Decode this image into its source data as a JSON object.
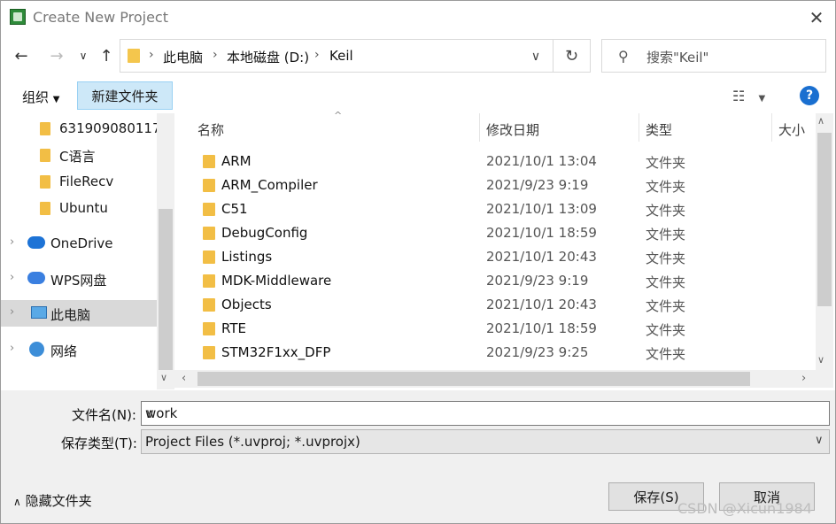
{
  "window": {
    "title": "Create New Project"
  },
  "nav": {
    "back_icon": "arrow-left-icon",
    "forward_icon": "arrow-right-icon",
    "recent_icon": "chevron-down-icon",
    "up_icon": "arrow-up-icon",
    "breadcrumb": [
      "此电脑",
      "本地磁盘 (D:)",
      "Keil"
    ],
    "search_placeholder": "搜索\"Keil\""
  },
  "toolbar": {
    "organize_label": "组织",
    "new_folder_label": "新建文件夹",
    "help_label": "?"
  },
  "sidebar": {
    "items": [
      {
        "label": "631909080117",
        "icon": "folder-icon"
      },
      {
        "label": "C语言",
        "icon": "folder-icon"
      },
      {
        "label": "FileRecv",
        "icon": "folder-icon"
      },
      {
        "label": "Ubuntu",
        "icon": "folder-icon"
      },
      {
        "label": "OneDrive",
        "icon": "onedrive-icon"
      },
      {
        "label": "WPS网盘",
        "icon": "wps-cloud-icon"
      },
      {
        "label": "此电脑",
        "icon": "computer-icon",
        "selected": true
      },
      {
        "label": "网络",
        "icon": "network-icon"
      }
    ]
  },
  "file_list": {
    "columns": [
      "名称",
      "修改日期",
      "类型",
      "大小"
    ],
    "rows": [
      {
        "name": "ARM",
        "date": "2021/10/1 13:04",
        "type": "文件夹"
      },
      {
        "name": "ARM_Compiler",
        "date": "2021/9/23 9:19",
        "type": "文件夹"
      },
      {
        "name": "C51",
        "date": "2021/10/1 13:09",
        "type": "文件夹"
      },
      {
        "name": "DebugConfig",
        "date": "2021/10/1 18:59",
        "type": "文件夹"
      },
      {
        "name": "Listings",
        "date": "2021/10/1 20:43",
        "type": "文件夹"
      },
      {
        "name": "MDK-Middleware",
        "date": "2021/9/23 9:19",
        "type": "文件夹"
      },
      {
        "name": "Objects",
        "date": "2021/10/1 20:43",
        "type": "文件夹"
      },
      {
        "name": "RTE",
        "date": "2021/10/1 18:59",
        "type": "文件夹"
      },
      {
        "name": "STM32F1xx_DFP",
        "date": "2021/9/23 9:25",
        "type": "文件夹"
      }
    ]
  },
  "form": {
    "filename_label": "文件名(N):",
    "filename_value": "work",
    "filetype_label": "保存类型(T):",
    "filetype_value": "Project Files (*.uvproj; *.uvprojx)",
    "hide_folders_label": "隐藏文件夹",
    "save_label": "保存(S)",
    "cancel_label": "取消"
  },
  "watermark": "CSDN @Xicun1984",
  "colors": {
    "accent": "#1a6fd0",
    "selection": "#cde8f8",
    "folder": "#f2be45"
  }
}
